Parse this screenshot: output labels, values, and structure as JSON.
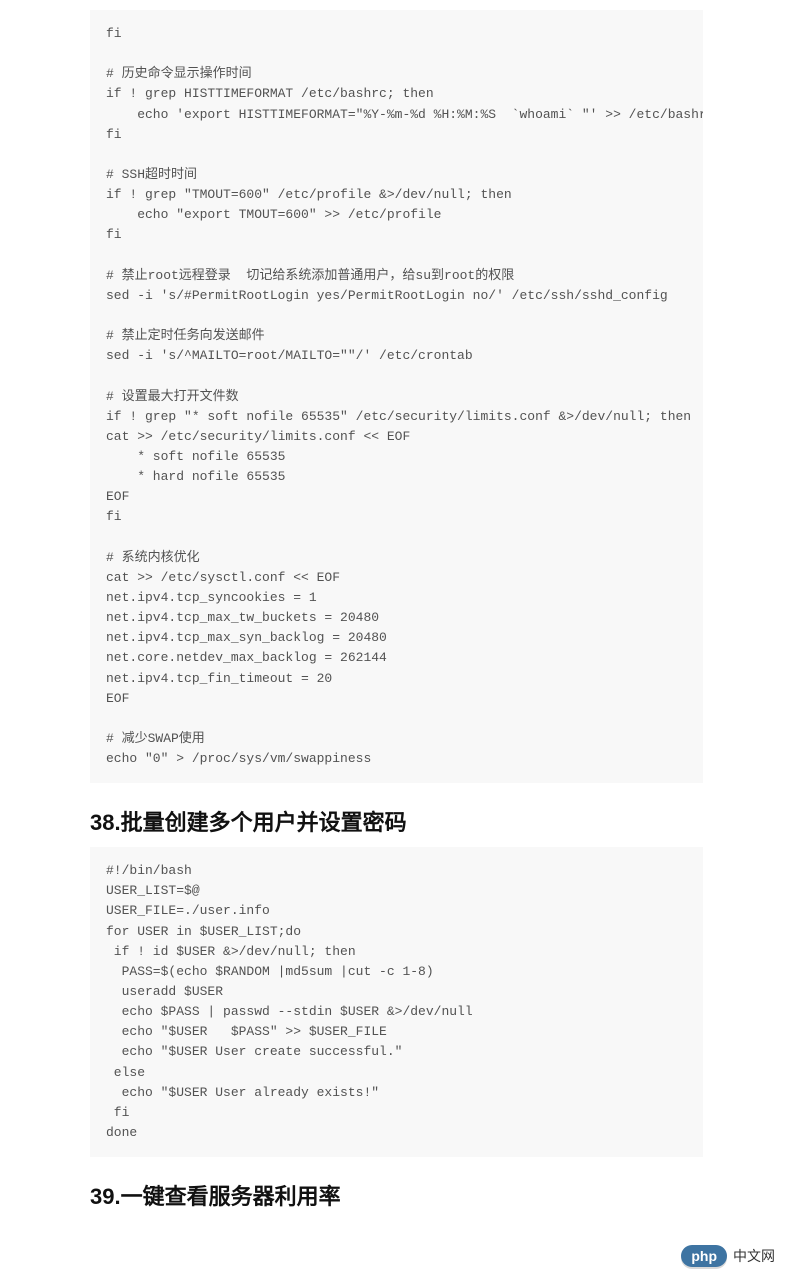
{
  "section38": {
    "heading": "38.批量创建多个用户并设置密码"
  },
  "section39": {
    "heading": "39.一键查看服务器利用率"
  },
  "code1": "fi\n\n# 历史命令显示操作时间\nif ! grep HISTTIMEFORMAT /etc/bashrc; then\n    echo 'export HISTTIMEFORMAT=\"%Y-%m-%d %H:%M:%S  `whoami` \"' >> /etc/bashrc\nfi\n\n# SSH超时时间\nif ! grep \"TMOUT=600\" /etc/profile &>/dev/null; then\n    echo \"export TMOUT=600\" >> /etc/profile\nfi\n\n# 禁止root远程登录  切记给系统添加普通用户，给su到root的权限\nsed -i 's/#PermitRootLogin yes/PermitRootLogin no/' /etc/ssh/sshd_config\n\n# 禁止定时任务向发送邮件\nsed -i 's/^MAILTO=root/MAILTO=\"\"/' /etc/crontab\n\n# 设置最大打开文件数\nif ! grep \"* soft nofile 65535\" /etc/security/limits.conf &>/dev/null; then\ncat >> /etc/security/limits.conf << EOF\n    * soft nofile 65535\n    * hard nofile 65535\nEOF\nfi\n\n# 系统内核优化\ncat >> /etc/sysctl.conf << EOF\nnet.ipv4.tcp_syncookies = 1\nnet.ipv4.tcp_max_tw_buckets = 20480\nnet.ipv4.tcp_max_syn_backlog = 20480\nnet.core.netdev_max_backlog = 262144\nnet.ipv4.tcp_fin_timeout = 20\nEOF\n\n# 减少SWAP使用\necho \"0\" > /proc/sys/vm/swappiness",
  "code2": "#!/bin/bash\nUSER_LIST=$@\nUSER_FILE=./user.info\nfor USER in $USER_LIST;do\n if ! id $USER &>/dev/null; then\n  PASS=$(echo $RANDOM |md5sum |cut -c 1-8)\n  useradd $USER\n  echo $PASS | passwd --stdin $USER &>/dev/null\n  echo \"$USER   $PASS\" >> $USER_FILE\n  echo \"$USER User create successful.\"\n else\n  echo \"$USER User already exists!\"\n fi\ndone",
  "footer": {
    "pill": "php",
    "label": "中文网"
  }
}
